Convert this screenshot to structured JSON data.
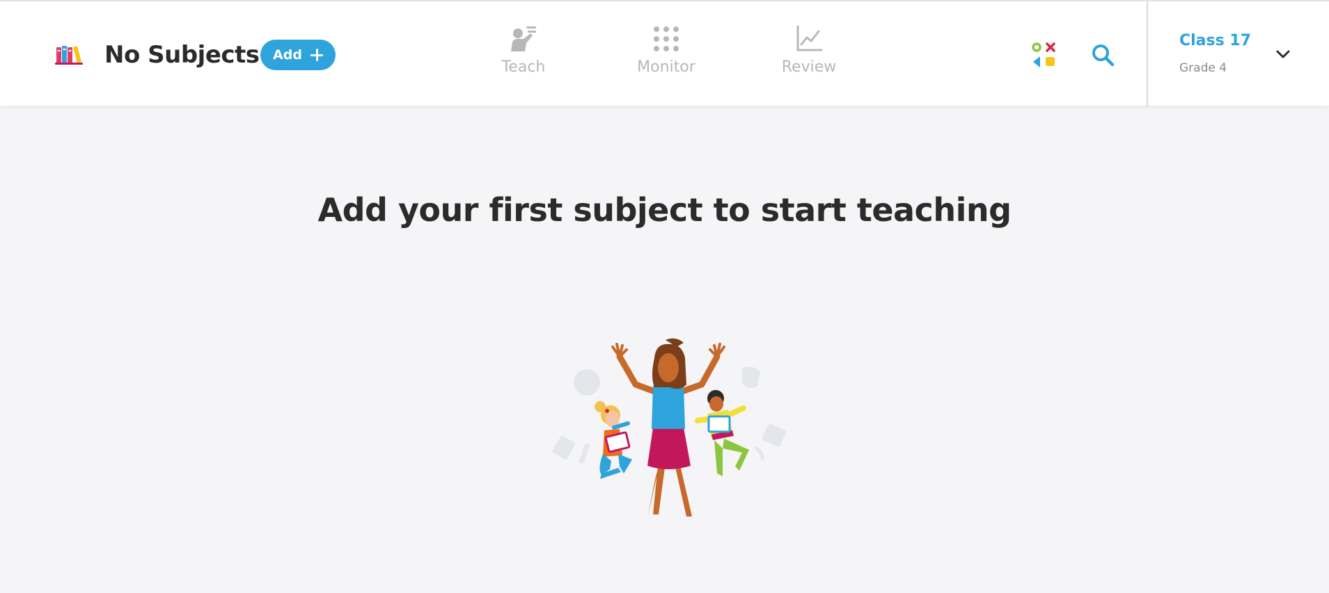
{
  "header": {
    "subject_title": "No Subjects",
    "add_label": "Add",
    "nav": [
      {
        "label": "Teach",
        "icon": "teach-icon"
      },
      {
        "label": "Monitor",
        "icon": "monitor-grid-icon"
      },
      {
        "label": "Review",
        "icon": "review-chart-icon"
      }
    ],
    "class_name": "Class 17",
    "class_grade": "Grade 4"
  },
  "main": {
    "heading": "Add your first subject to start teaching"
  },
  "colors": {
    "accent": "#2ea3dc",
    "nav_inactive": "#b7b7b7",
    "background": "#f5f5f7"
  }
}
